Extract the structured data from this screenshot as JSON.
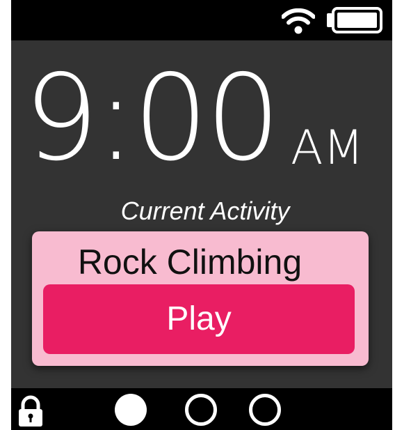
{
  "status_bar": {
    "wifi_icon": "wifi-icon",
    "battery_icon": "battery-full-icon",
    "battery_level": 1.0
  },
  "clock": {
    "time": "9:00",
    "meridiem": "AM"
  },
  "activity": {
    "heading": "Current Activity",
    "name": "Rock Climbing",
    "play_label": "Play"
  },
  "nav": {
    "lock_icon": "lock-icon",
    "pages": [
      {
        "active": true
      },
      {
        "active": false
      },
      {
        "active": false
      }
    ]
  },
  "colors": {
    "background": "#333333",
    "bars": "#000000",
    "card": "#f8bbd0",
    "accent": "#e91e63",
    "text_light": "#ffffff",
    "text_dark": "#111111"
  }
}
